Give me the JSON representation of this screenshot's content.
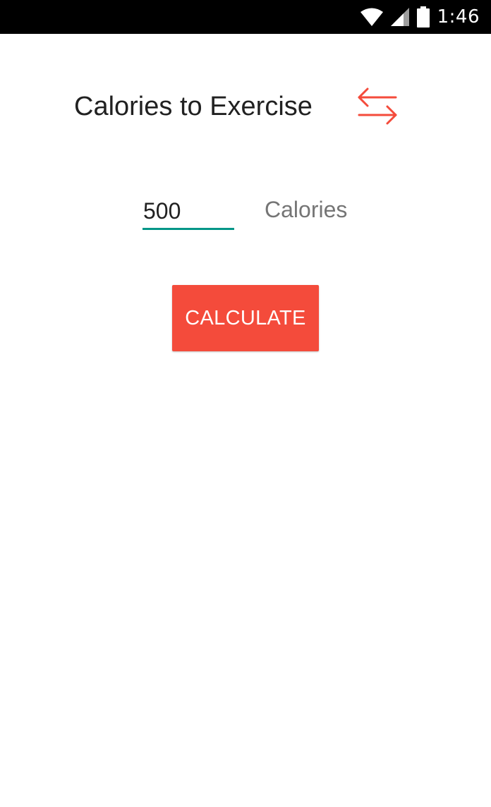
{
  "status_bar": {
    "time": "1:46",
    "icons": [
      "wifi-icon",
      "cell-signal-icon",
      "battery-icon"
    ],
    "background": "#000000"
  },
  "header": {
    "title": "Calories to Exercise",
    "swap_icon": "swap-arrows-icon"
  },
  "form": {
    "calories_value": "500",
    "unit_label": "Calories"
  },
  "actions": {
    "calculate_label": "CALCULATE"
  },
  "colors": {
    "accent": "#f44b3b",
    "input_underline": "#009688",
    "title_text": "#212121",
    "secondary_text": "#757575"
  }
}
